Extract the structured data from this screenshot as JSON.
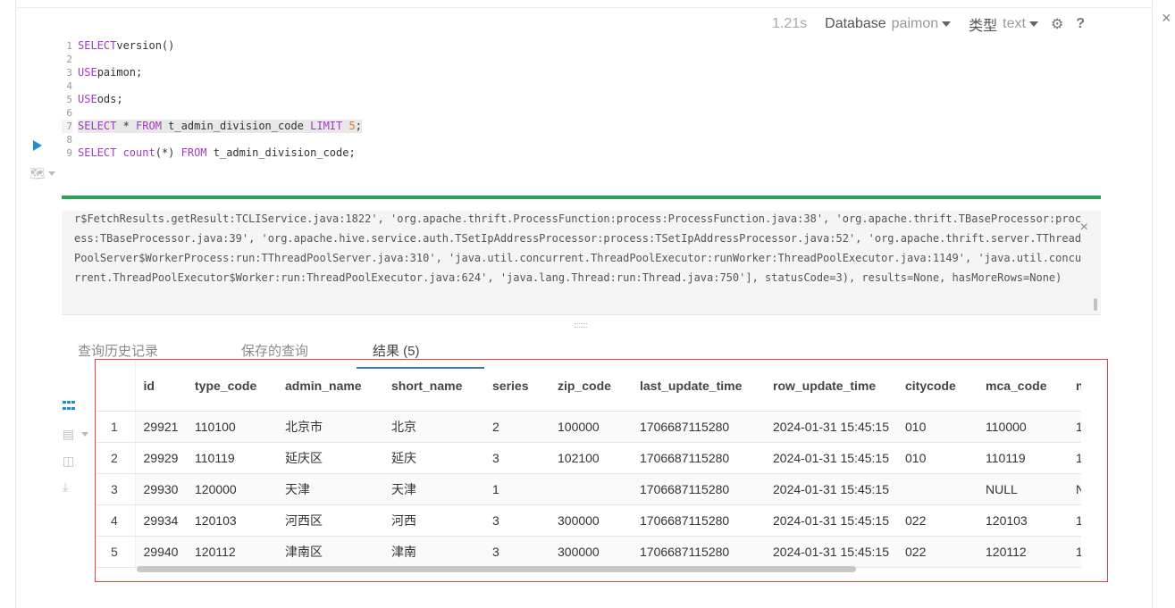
{
  "toolbar": {
    "elapsed": "1.21s",
    "database_label": "Database",
    "database_value": "paimon",
    "type_label": "类型",
    "type_value": "text",
    "settings_icon": "gear-icon",
    "help_label": "?"
  },
  "window": {
    "close_label": "×"
  },
  "editor": {
    "lines": [
      {
        "n": "1",
        "parts": [
          [
            "kw",
            "SELECT"
          ],
          [
            "",
            "version()"
          ]
        ]
      },
      {
        "n": "2",
        "parts": []
      },
      {
        "n": "3",
        "parts": [
          [
            "kw",
            "USE"
          ],
          [
            "",
            "paimon;"
          ]
        ]
      },
      {
        "n": "4",
        "parts": []
      },
      {
        "n": "5",
        "parts": [
          [
            "kw",
            "USE"
          ],
          [
            "",
            "ods;"
          ]
        ]
      },
      {
        "n": "6",
        "parts": []
      },
      {
        "n": "7",
        "active": true,
        "parts": [
          [
            "kw",
            "SELECT"
          ],
          [
            "",
            " * "
          ],
          [
            "kw",
            "FROM"
          ],
          [
            "",
            " t_admin_division_code "
          ],
          [
            "kw",
            "LIMIT"
          ],
          [
            "",
            " "
          ],
          [
            "num",
            "5"
          ],
          [
            "",
            ";"
          ]
        ]
      },
      {
        "n": "8",
        "parts": []
      },
      {
        "n": "9",
        "parts": [
          [
            "kw",
            "SELECT"
          ],
          [
            "kw",
            " count"
          ],
          [
            "",
            "(*) "
          ],
          [
            "kw",
            "FROM"
          ],
          [
            "",
            " t_admin_division_code;"
          ]
        ]
      }
    ]
  },
  "log": {
    "text": "r$FetchResults.getResult:TCLIService.java:1822', 'org.apache.thrift.ProcessFunction:process:ProcessFunction.java:38', 'org.apache.thrift.TBaseProcessor:process:TBaseProcessor.java:39', 'org.apache.hive.service.auth.TSetIpAddressProcessor:process:TSetIpAddressProcessor.java:52', 'org.apache.thrift.server.TThreadPoolServer$WorkerProcess:run:TThreadPoolServer.java:310', 'java.util.concurrent.ThreadPoolExecutor:runWorker:ThreadPoolExecutor.java:1149', 'java.util.concurrent.ThreadPoolExecutor$Worker:run:ThreadPoolExecutor.java:624', 'java.lang.Thread:run:Thread.java:750'], statusCode=3), results=None, hasMoreRows=None)",
    "close_label": "×"
  },
  "tabs": {
    "history": "查询历史记录",
    "saved": "保存的查询",
    "results": "结果 (5)"
  },
  "results": {
    "columns": [
      "id",
      "type_code",
      "admin_name",
      "short_name",
      "series",
      "zip_code",
      "last_update_time",
      "row_update_time",
      "citycode",
      "mca_code",
      "n"
    ],
    "rows": [
      [
        "1",
        "29921",
        "110100",
        "北京市",
        "北京",
        "2",
        "100000",
        "1706687115280",
        "2024-01-31 15:45:15",
        "010",
        "110000",
        "1"
      ],
      [
        "2",
        "29929",
        "110119",
        "延庆区",
        "延庆",
        "3",
        "102100",
        "1706687115280",
        "2024-01-31 15:45:15",
        "010",
        "110119",
        "1"
      ],
      [
        "3",
        "29930",
        "120000",
        "天津",
        "天津",
        "1",
        "",
        "1706687115280",
        "2024-01-31 15:45:15",
        "",
        "NULL",
        "N"
      ],
      [
        "4",
        "29934",
        "120103",
        "河西区",
        "河西",
        "3",
        "300000",
        "1706687115280",
        "2024-01-31 15:45:15",
        "022",
        "120103",
        "1"
      ],
      [
        "5",
        "29940",
        "120112",
        "津南区",
        "津南",
        "3",
        "300000",
        "1706687115280",
        "2024-01-31 15:45:15",
        "022",
        "120112",
        "1"
      ]
    ]
  }
}
